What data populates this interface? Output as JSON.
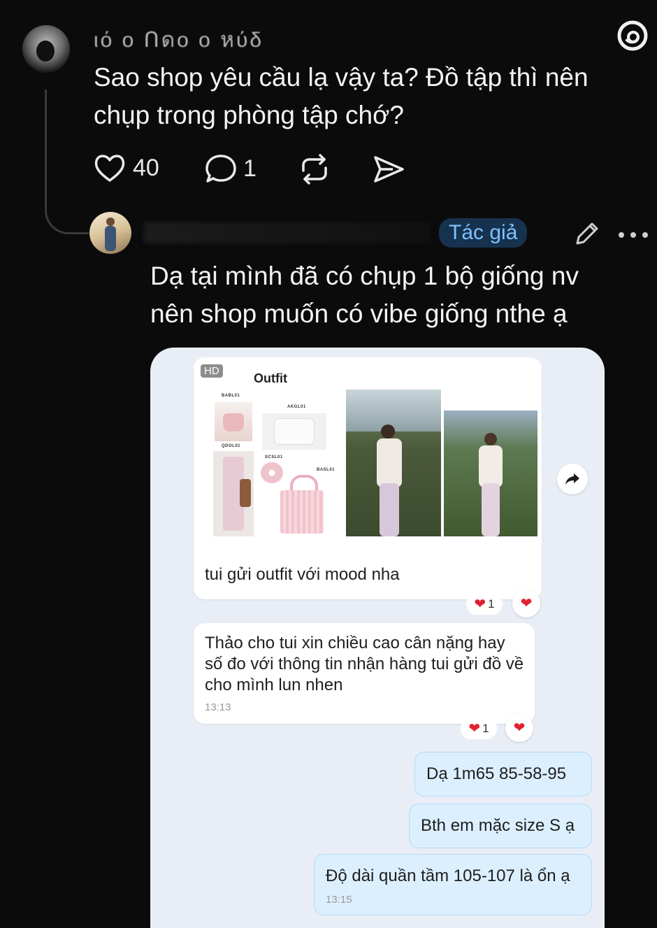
{
  "post": {
    "username": "ιό ο Ոดο ο หύδ",
    "text": "Sao shop yêu cầu lạ vậy ta? Đồ tập thì nên chụp trong phòng tập chớ?",
    "likes": "40",
    "replies": "1"
  },
  "reply": {
    "badge": "Tác giả",
    "text": "Dạ tại mình đã có chụp 1 bộ giống nv nên shop muốn có vibe giống nthe ạ"
  },
  "chat": {
    "hd_badge": "HD",
    "outfit_title": "Outfit",
    "product_labels": [
      "BABL01",
      "AKGL01",
      "QDOL01",
      "SCSL01",
      "BASL01"
    ],
    "outfit_caption": "tui gửi outfit với mood nha",
    "outfit_reaction_count": "1",
    "message_1": "Thảo cho tui xin chiều cao cân nặng hay số đo với thông tin nhận hàng tui gửi đồ về cho mình lun nhen",
    "message_1_time": "13:13",
    "message_1_reaction_count": "1",
    "reply_1": "Dạ 1m65 85-58-95",
    "reply_2": "Bth em mặc size S ạ",
    "reply_3": "Độ dài quần tầm 105-107 là ổn ạ",
    "reply_3_time": "13:15"
  },
  "colors": {
    "background": "#0b0b0b",
    "chat_bg": "#e9eef6",
    "badge_text": "#7ec1ff",
    "heart": "#e0222f"
  }
}
